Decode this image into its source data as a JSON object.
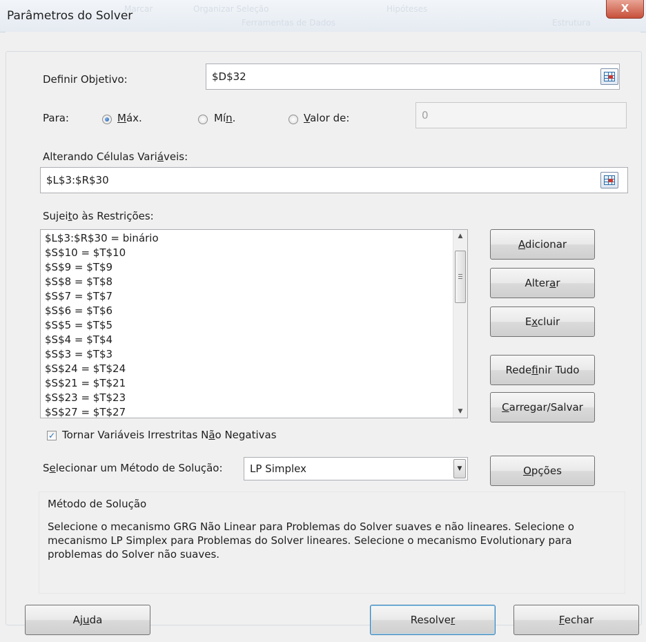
{
  "window": {
    "title": "Parâmetros do Solver",
    "close_label": "X",
    "background_ghost_texts": [
      "Marcar",
      "Organizar Seleção",
      "Ferramentas de Dados",
      "Hipóteses",
      "Estrutura"
    ]
  },
  "objective": {
    "label_pre": "Definir Ob",
    "label_u": "j",
    "label_post": "etivo:",
    "value": "$D$32"
  },
  "to": {
    "label": "Para:",
    "max_u": "M",
    "max_rest": "áx.",
    "min_pre": "Mí",
    "min_u": "n",
    "min_post": ".",
    "value_u": "V",
    "value_rest": "alor de:",
    "value_field": "0",
    "selected": "max"
  },
  "variables": {
    "label_pre": "Alterando Células Vari",
    "label_u": "á",
    "label_post": "veis:",
    "value": "$L$3:$R$30"
  },
  "constraints": {
    "label_pre": "Sujei",
    "label_u": "t",
    "label_post": "o às Restrições:",
    "items": [
      "$L$3:$R$30 = binário",
      "$S$10 = $T$10",
      "$S$9 = $T$9",
      "$S$8 = $T$8",
      "$S$7 = $T$7",
      "$S$6 = $T$6",
      "$S$5 = $T$5",
      "$S$4 = $T$4",
      "$S$3 = $T$3",
      "$S$24 = $T$24",
      "$S$21 = $T$21",
      "$S$23 = $T$23",
      "$S$27 = $T$27"
    ]
  },
  "buttons": {
    "add_u": "A",
    "add_rest": "dicionar",
    "change_pre": "Alter",
    "change_u": "a",
    "change_post": "r",
    "delete_pre": "E",
    "delete_u": "x",
    "delete_post": "cluir",
    "reset_pre": "Rede",
    "reset_u": "f",
    "reset_post": "inir Tudo",
    "loadsave_u": "C",
    "loadsave_rest": "arregar/Salvar",
    "options_u": "O",
    "options_rest": "pções",
    "help_pre": "Aj",
    "help_u": "u",
    "help_post": "da",
    "solve_pre": "Resolve",
    "solve_u": "r",
    "close_u": "F",
    "close_rest": "echar"
  },
  "nonnegative": {
    "checked": true,
    "label_pre": "Tornar Variáveis Irrestritas N",
    "label_u": "ã",
    "label_post": "o Negativas"
  },
  "method": {
    "label_u": "e",
    "label_pre": "S",
    "label_post": "lecionar um Método de Solução:",
    "selected": "LP Simplex",
    "panel_title": "Método de Solução",
    "description": "Selecione o mecanismo GRG Não Linear para Problemas do Solver suaves e não lineares. Selecione o mecanismo LP Simplex para Problemas do Solver lineares. Selecione o mecanismo Evolutionary para problemas do Solver não suaves."
  }
}
